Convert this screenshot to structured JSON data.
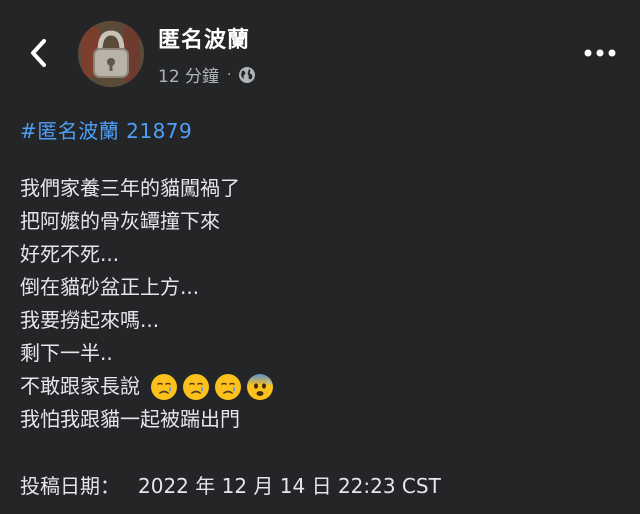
{
  "header": {
    "page_name": "匿名波蘭",
    "time_ago": "12 分鐘",
    "separator": "·",
    "icons": [
      "back-chevron-icon",
      "avatar",
      "globe-icon",
      "more-options-icon"
    ]
  },
  "post": {
    "hashtag": "#匿名波蘭 21879",
    "lines": [
      "我們家養三年的貓闖禍了",
      "把阿嬤的骨灰罈撞下來",
      "好死不死...",
      "倒在貓砂盆正上方...",
      "我要撈起來嗎...",
      "剩下一半..",
      "不敢跟家長說",
      "我怕我跟貓一起被踹出門"
    ],
    "emojis": [
      "crying-face-emoji",
      "crying-face-emoji",
      "crying-face-emoji",
      "anxious-sweat-face-emoji"
    ],
    "date_label": "投稿日期：",
    "date_value": "2022 年 12 月 14 日 22:23 CST"
  },
  "colors": {
    "background": "#242526",
    "text": "#e4e6eb",
    "secondary_text": "#b0b3b8",
    "hashtag": "#4e9ff6"
  }
}
